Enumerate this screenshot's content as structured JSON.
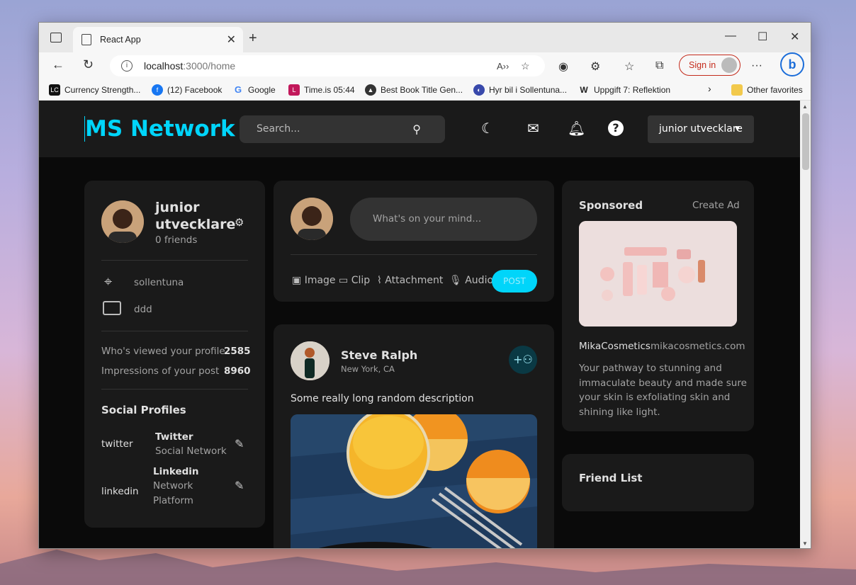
{
  "browser": {
    "tab_title": "React App",
    "url_host": "localhost",
    "url_path": ":3000/home",
    "sign_in": "Sign in",
    "bookmarks": [
      "Currency Strength...",
      "(12) Facebook",
      "Google",
      "Time.is 05:44",
      "Best Book Title Gen...",
      "Hyr bil i Sollentuna...",
      "Uppgift 7: Reflektion"
    ],
    "other_favorites": "Other favorites"
  },
  "nav": {
    "logo": "MS Network",
    "search_placeholder": "Search...",
    "user_select": "junior utvecklare"
  },
  "profile": {
    "name_line1": "junior",
    "name_line2": "utvecklare",
    "friends": "0 friends",
    "location": "sollentuna",
    "occupation": "ddd",
    "viewed_label": "Who's viewed your profile",
    "viewed_value": "2585",
    "impressions_label": "Impressions of your post",
    "impressions_value": "8960",
    "social_title": "Social Profiles",
    "socials": [
      {
        "alt": "twitter",
        "name": "Twitter",
        "desc": "Social Network"
      },
      {
        "alt": "linkedin",
        "name": "Linkedin",
        "desc_line1": "Network",
        "desc_line2": "Platform"
      }
    ]
  },
  "composer": {
    "placeholder": "What's on your mind...",
    "image": "Image",
    "clip": "Clip",
    "attachment": "Attachment",
    "audio": "Audio",
    "post": "POST"
  },
  "feed": {
    "author": "Steve Ralph",
    "location": "New York, CA",
    "description": "Some really long random description"
  },
  "ad": {
    "title": "Sponsored",
    "create": "Create Ad",
    "brand": "MikaCosmetics",
    "site": "mikacosmetics.com",
    "text_lines": [
      "Your pathway to stunning and",
      "immaculate beauty and made sure",
      "your skin is exfoliating skin and",
      "shining like light."
    ]
  },
  "friends": {
    "title": "Friend List"
  },
  "colors": {
    "accent": "#00d5fa",
    "card": "#1a1a1a",
    "bg": "#0a0a0a"
  }
}
